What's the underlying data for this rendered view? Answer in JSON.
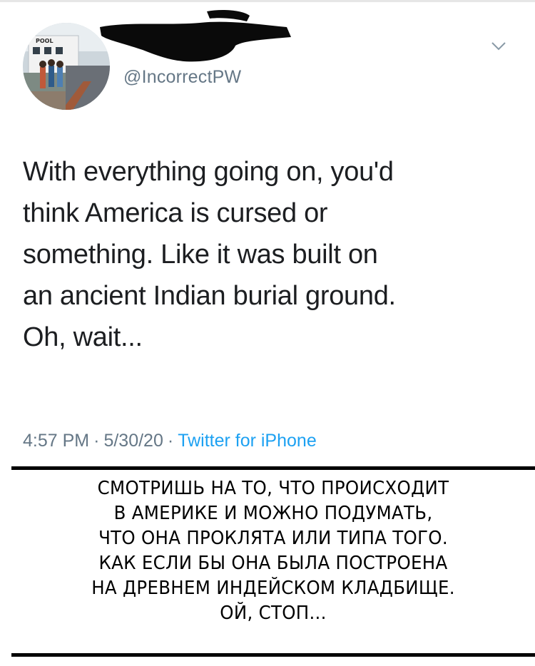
{
  "tweet": {
    "handle": "@IncorrectPW",
    "text": "With everything going on, you'd\nthink America is cursed or\nsomething. Like it was built on\nan ancient Indian burial ground.\nOh, wait...",
    "time": "4:57 PM",
    "date": "5/30/20",
    "source": "Twitter for iPhone",
    "separator": "·",
    "avatar_sign_text": "POOL"
  },
  "icons": {
    "menu": "chevron-down-icon",
    "avatar": "profile-photo"
  },
  "caption": {
    "text": "СМОТРИШЬ НА ТО, ЧТО ПРОИСХОДИТ\nВ АМЕРИКЕ И МОЖНО ПОДУМАТЬ,\nЧТО ОНА ПРОКЛЯТА ИЛИ ТИПА ТОГО.\nКАК ЕСЛИ БЫ ОНА БЫЛА ПОСТРОЕНА\nНА ДРЕВНЕМ ИНДЕЙСКОМ КЛАДБИЩЕ.\nОЙ, СТОП..."
  },
  "colors": {
    "text": "#1c1e21",
    "meta": "#657786",
    "link": "#1da1f2",
    "rule": "#000000"
  }
}
